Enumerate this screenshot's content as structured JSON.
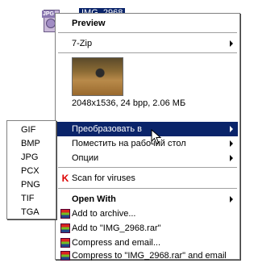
{
  "desktop": {
    "file_tag": "JPG",
    "file_name": "IMG_2968"
  },
  "menu": {
    "preview": "Preview",
    "seven_zip": "7-Zip",
    "image_info": "2048x1536, 24 bpp, 2.06 МБ",
    "convert": "Преобразовать в",
    "set_desktop": "Поместить на рабочий стол",
    "options": "Опции",
    "scan": "Scan for viruses",
    "open_with": "Open With",
    "add_archive": "Add to archive...",
    "add_rar": "Add to \"IMG_2968.rar\"",
    "compress_email": "Compress and email...",
    "compress_rar_email": "Compress to \"IMG_2968.rar\" and email"
  },
  "submenu": {
    "items": [
      "GIF",
      "BMP",
      "JPG",
      "PCX",
      "PNG",
      "TIF",
      "TGA"
    ]
  },
  "colors": {
    "highlight": "#0a246a",
    "menu_bg": "#ffffff",
    "antivirus_red": "#d00000"
  }
}
